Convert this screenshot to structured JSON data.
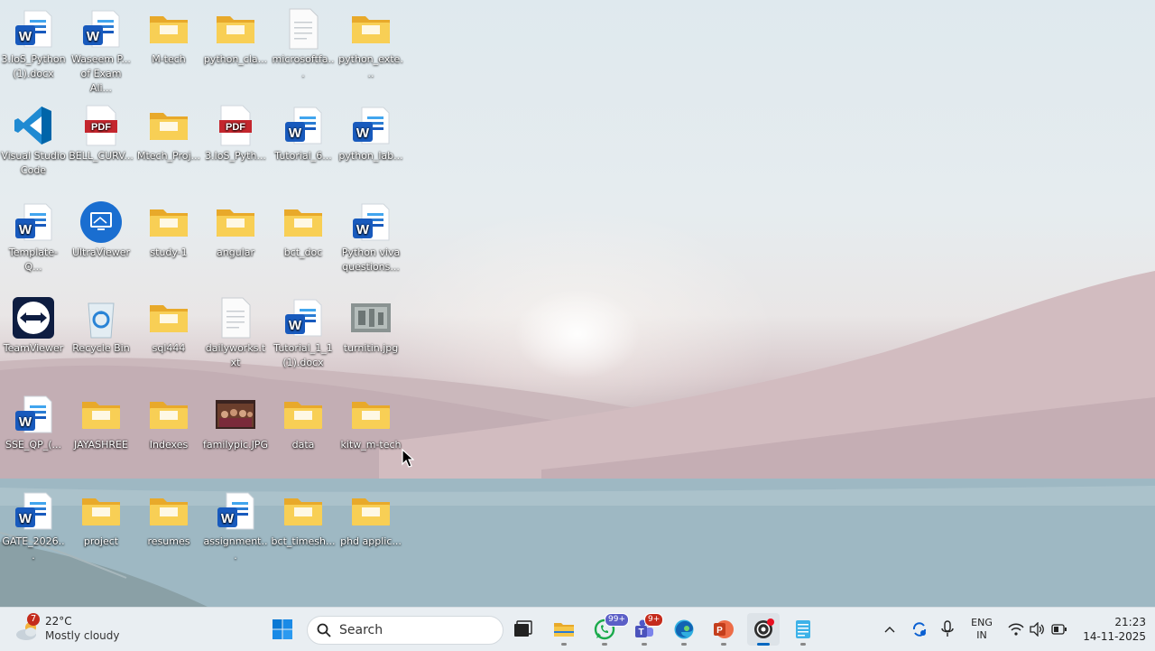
{
  "desktop": {
    "icons": [
      {
        "label": "3.IoS_Python (1).docx",
        "type": "word"
      },
      {
        "label": "Waseem P... of Exam Ali...",
        "type": "word"
      },
      {
        "label": "M-tech",
        "type": "folder"
      },
      {
        "label": "python_cla...",
        "type": "folder"
      },
      {
        "label": "microsoftfa...",
        "type": "text-file"
      },
      {
        "label": "python_exte...",
        "type": "folder"
      },
      {
        "label": "Visual Studio Code",
        "type": "vscode"
      },
      {
        "label": "BELL_CURV...",
        "type": "pdf"
      },
      {
        "label": "Mtech_Proj...",
        "type": "folder"
      },
      {
        "label": "3.IoS_Pyth...",
        "type": "pdf"
      },
      {
        "label": "Tutorial_6...",
        "type": "word"
      },
      {
        "label": "python_lab...",
        "type": "word"
      },
      {
        "label": "Template-Q...",
        "type": "word"
      },
      {
        "label": "UltraViewer",
        "type": "ultraviewer"
      },
      {
        "label": "study-1",
        "type": "folder"
      },
      {
        "label": "angular",
        "type": "folder"
      },
      {
        "label": "bct_doc",
        "type": "folder"
      },
      {
        "label": "Python viva questions...",
        "type": "word"
      },
      {
        "label": "TeamViewer",
        "type": "teamviewer"
      },
      {
        "label": "Recycle Bin",
        "type": "recycle-bin"
      },
      {
        "label": "sql444",
        "type": "folder"
      },
      {
        "label": "dailyworks.txt",
        "type": "text-file"
      },
      {
        "label": "Tutorial_1_1 (1).docx",
        "type": "word"
      },
      {
        "label": "turnitin.jpg",
        "type": "image"
      },
      {
        "label": "SSE_QP_(...",
        "type": "word"
      },
      {
        "label": "JAYASHREE",
        "type": "folder"
      },
      {
        "label": "Indexes",
        "type": "folder"
      },
      {
        "label": "familypic.JPG",
        "type": "photo"
      },
      {
        "label": "data",
        "type": "folder"
      },
      {
        "label": "kitw_m-tech",
        "type": "folder"
      },
      {
        "label": "GATE_2026...",
        "type": "word"
      },
      {
        "label": "project",
        "type": "folder"
      },
      {
        "label": "resumes",
        "type": "folder"
      },
      {
        "label": "assignment...",
        "type": "word"
      },
      {
        "label": "bct_timesh...",
        "type": "folder"
      },
      {
        "label": "phd applic...",
        "type": "folder"
      }
    ]
  },
  "taskbar": {
    "weather": {
      "badge": "7",
      "temp": "22°C",
      "condition": "Mostly cloudy",
      "icon": "cloud-sun-icon"
    },
    "search": {
      "placeholder": "Search",
      "icon": "search-icon"
    },
    "apps": [
      {
        "name": "start",
        "icon": "windows-logo-icon"
      },
      {
        "name": "task-view",
        "icon": "task-view-icon"
      },
      {
        "name": "file-explorer",
        "icon": "folder-icon",
        "running": true
      },
      {
        "name": "whatsapp",
        "icon": "whatsapp-icon",
        "badge": "99+",
        "running": true
      },
      {
        "name": "teams",
        "icon": "teams-icon",
        "badge": "9+",
        "running": true
      },
      {
        "name": "edge",
        "icon": "edge-icon",
        "running": true
      },
      {
        "name": "powerpoint",
        "icon": "powerpoint-icon",
        "running": true
      },
      {
        "name": "obs",
        "icon": "record-icon",
        "running": true,
        "active": true
      },
      {
        "name": "notepad",
        "icon": "notepad-icon",
        "running": true
      }
    ],
    "tray": {
      "language_line1": "ENG",
      "language_line2": "IN",
      "time": "21:23",
      "date": "14-11-2025"
    }
  }
}
